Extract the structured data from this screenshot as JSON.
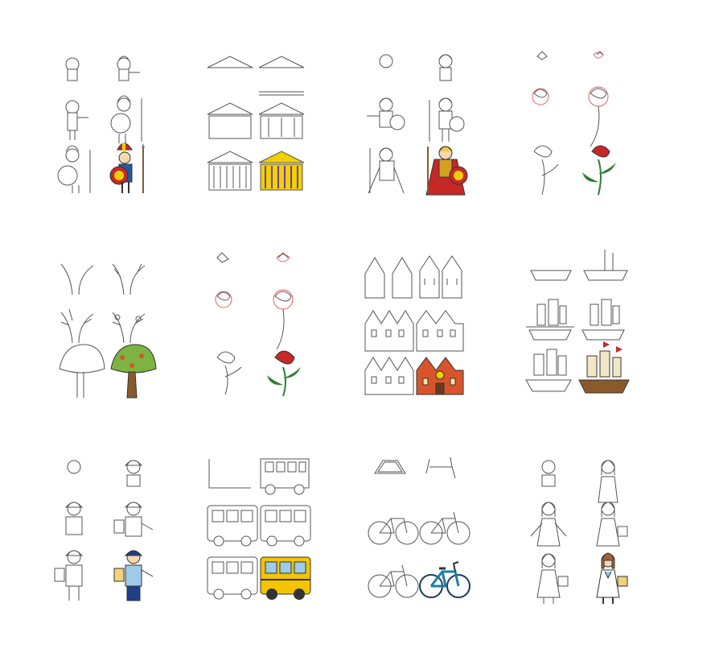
{
  "page": {
    "background": "#ffffff"
  },
  "cards": [
    {
      "subject": "spartan-warrior",
      "steps": 6,
      "colored_step": 6
    },
    {
      "subject": "greek-temple",
      "steps": 6,
      "colored_step": 6
    },
    {
      "subject": "roman-gladiator",
      "steps": 6,
      "colored_step": 6
    },
    {
      "subject": "rose-red",
      "steps": 6,
      "colored_step": 6
    },
    {
      "subject": "tree",
      "steps": 6,
      "colored_step": 6
    },
    {
      "subject": "rose",
      "steps": 6,
      "colored_step": 6
    },
    {
      "subject": "town-houses",
      "steps": 6,
      "colored_step": 6
    },
    {
      "subject": "sailing-ship",
      "steps": 6,
      "colored_step": 6
    },
    {
      "subject": "policeman",
      "steps": 6,
      "colored_step": 6
    },
    {
      "subject": "school-bus",
      "steps": 6,
      "colored_step": 6
    },
    {
      "subject": "bicycle",
      "steps": 6,
      "colored_step": 6
    },
    {
      "subject": "doctor",
      "steps": 6,
      "colored_step": 6
    }
  ],
  "colors": {
    "line": "#555555",
    "guide": "#e06060",
    "red": "#c62828",
    "yellow": "#f2d000",
    "blue": "#1e5aa8",
    "green": "#2e7d32",
    "brown": "#8b5a2b",
    "orange": "#d9542b",
    "teal": "#1b7fa6"
  }
}
